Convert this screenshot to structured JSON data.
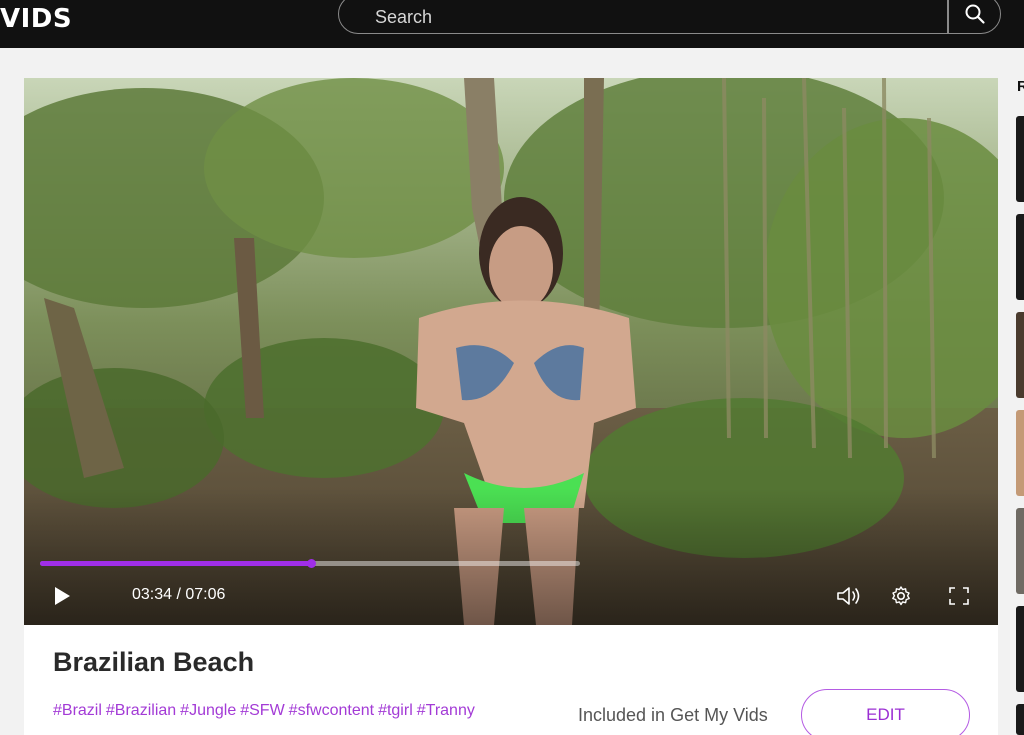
{
  "header": {
    "logo": "VIDS",
    "search_placeholder": "Search",
    "search_icon": "search-icon"
  },
  "player": {
    "current_time": "03:34",
    "duration": "07:06",
    "time_display": "03:34 / 07:06",
    "progress_fraction": 0.502,
    "buffered_fraction": 1.0,
    "accent_color": "#a02ee8",
    "icons": [
      "play-icon",
      "volume-icon",
      "settings-icon",
      "fullscreen-icon"
    ]
  },
  "video": {
    "title": "Brazilian Beach",
    "tags": [
      "#Brazil",
      "#Brazilian",
      "#Jungle",
      "#SFW",
      "#sfwcontent",
      "#tgirl",
      "#Tranny"
    ],
    "included_text": "Included in Get My Vids",
    "edit_label": "EDIT"
  },
  "sidebar": {
    "heading_initial": "R"
  }
}
